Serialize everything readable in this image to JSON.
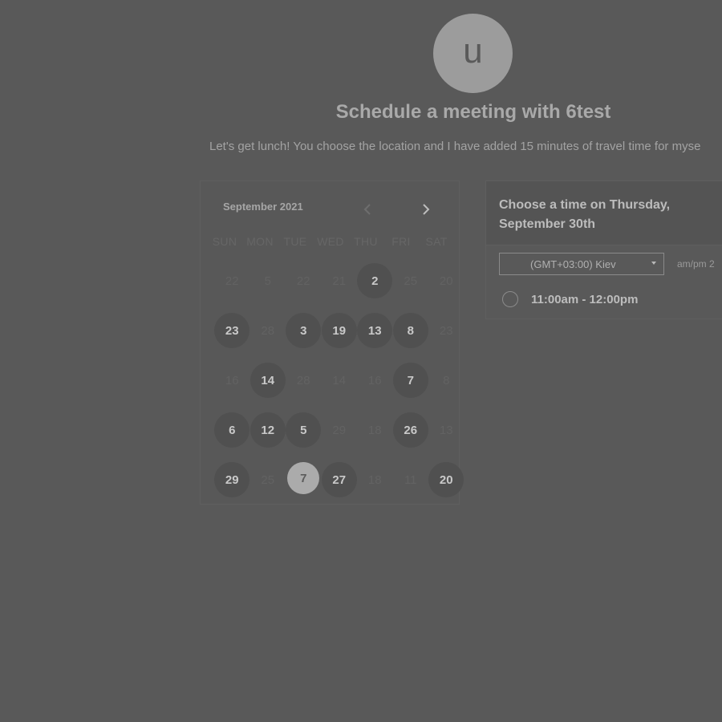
{
  "avatar": {
    "initial": "u"
  },
  "title": "Schedule a meeting with 6test",
  "subtitle": "Let's get lunch! You choose the location and I have added 15 minutes of travel time for myse",
  "calendar": {
    "month_label": "September 2021",
    "weekdays": [
      "SUN",
      "MON",
      "TUE",
      "WED",
      "THU",
      "FRI",
      "SAT"
    ],
    "weeks": [
      [
        {
          "label": "22",
          "available": false
        },
        {
          "label": "5",
          "available": false
        },
        {
          "label": "22",
          "available": false
        },
        {
          "label": "21",
          "available": false
        },
        {
          "label": "2",
          "available": true
        },
        {
          "label": "25",
          "available": false
        },
        {
          "label": "20",
          "available": false
        }
      ],
      [
        {
          "label": "23",
          "available": true
        },
        {
          "label": "28",
          "available": false
        },
        {
          "label": "3",
          "available": true
        },
        {
          "label": "19",
          "available": true
        },
        {
          "label": "13",
          "available": true
        },
        {
          "label": "8",
          "available": true
        },
        {
          "label": "23",
          "available": false
        }
      ],
      [
        {
          "label": "16",
          "available": false
        },
        {
          "label": "14",
          "available": true
        },
        {
          "label": "28",
          "available": false
        },
        {
          "label": "14",
          "available": false
        },
        {
          "label": "16",
          "available": false
        },
        {
          "label": "7",
          "available": true
        },
        {
          "label": "8",
          "available": false
        }
      ],
      [
        {
          "label": "6",
          "available": true
        },
        {
          "label": "12",
          "available": true
        },
        {
          "label": "5",
          "available": true
        },
        {
          "label": "29",
          "available": false
        },
        {
          "label": "18",
          "available": false
        },
        {
          "label": "26",
          "available": true
        },
        {
          "label": "13",
          "available": false
        }
      ],
      [
        {
          "label": "29",
          "available": true
        },
        {
          "label": "25",
          "available": false
        },
        {
          "label": "7",
          "available": true,
          "selected": true
        },
        {
          "label": "27",
          "available": true
        },
        {
          "label": "18",
          "available": false
        },
        {
          "label": "11",
          "available": false
        },
        {
          "label": "20",
          "available": true
        }
      ]
    ]
  },
  "time_panel": {
    "title": "Choose a time on Thursday, September 30th",
    "timezone": "(GMT+03:00) Kiev",
    "format_label": "am/pm  2",
    "slots": [
      "11:00am - 12:00pm"
    ]
  },
  "colors": {
    "background": "#595959",
    "available_day": "#505050",
    "selected_day": "#ababab"
  }
}
